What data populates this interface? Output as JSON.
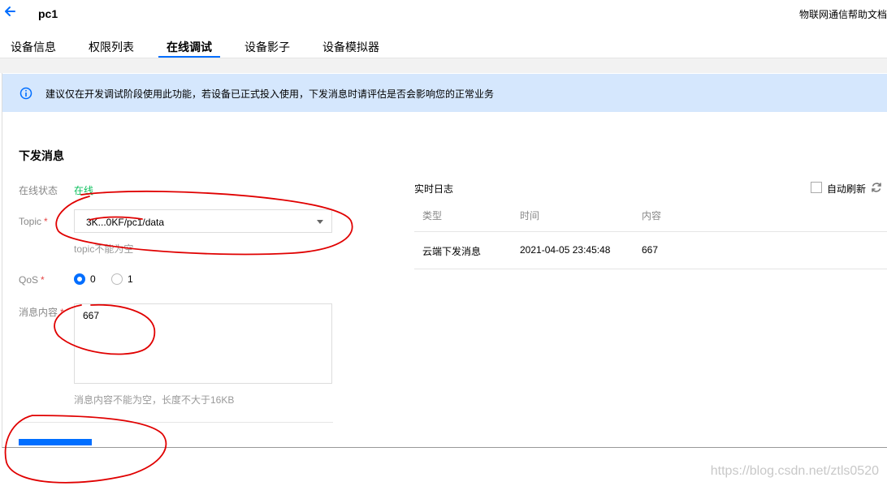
{
  "header": {
    "title": "pc1",
    "help_link": "物联网通信帮助文档"
  },
  "tabs": [
    {
      "label": "设备信息"
    },
    {
      "label": "权限列表"
    },
    {
      "label": "在线调试"
    },
    {
      "label": "设备影子"
    },
    {
      "label": "设备模拟器"
    }
  ],
  "notice": {
    "text": "建议仅在开发调试阶段使用此功能，若设备已正式投入使用，下发消息时请评估是否会影响您的正常业务"
  },
  "form": {
    "section_title": "下发消息",
    "status": {
      "label": "在线状态",
      "value": "在线"
    },
    "topic": {
      "label": "Topic",
      "value": "3K...0KF/pc1/data",
      "hint": "topic不能为空"
    },
    "qos": {
      "label": "QoS",
      "options": [
        "0",
        "1"
      ],
      "selected": "0"
    },
    "message": {
      "label": "消息内容",
      "value": "667",
      "hint": "消息内容不能为空，长度不大于16KB"
    }
  },
  "log": {
    "title": "实时日志",
    "auto_refresh_label": "自动刷新",
    "auto_refresh_checked": false,
    "columns": [
      "类型",
      "时间",
      "内容"
    ],
    "rows": [
      {
        "type": "云端下发消息",
        "time": "2021-04-05 23:45:48",
        "content": "667"
      }
    ]
  },
  "watermark": "https://blog.csdn.net/ztls0520",
  "colors": {
    "accent": "#006eff",
    "online": "#0abf5b",
    "notice_bg": "#d5e7fd",
    "required": "#e54545",
    "annotation": "#e00000"
  }
}
